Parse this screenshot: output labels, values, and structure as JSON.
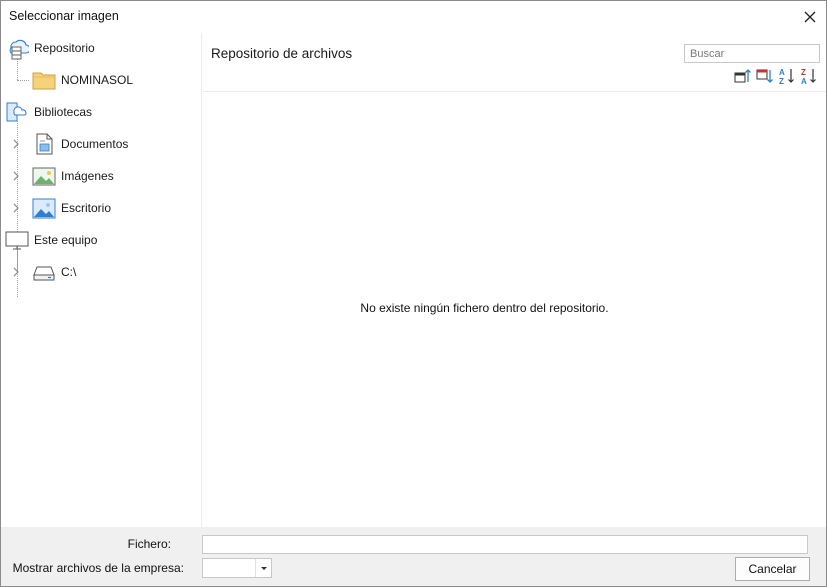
{
  "window": {
    "title": "Seleccionar imagen",
    "close_icon": "close-icon"
  },
  "sidebar": {
    "items": [
      {
        "label": "Repositorio",
        "icon": "cloud-server-icon"
      },
      {
        "label": "NOMINASOL",
        "icon": "folder-icon"
      },
      {
        "label": "Bibliotecas",
        "icon": "library-cloud-icon"
      },
      {
        "label": "Documentos",
        "icon": "document-icon"
      },
      {
        "label": "Imágenes",
        "icon": "image-icon"
      },
      {
        "label": "Escritorio",
        "icon": "desktop-image-icon"
      },
      {
        "label": "Este equipo",
        "icon": "monitor-icon"
      },
      {
        "label": "C:\\",
        "icon": "drive-icon"
      }
    ]
  },
  "main": {
    "title": "Repositorio de archivos",
    "search": {
      "placeholder": "Buscar",
      "value": ""
    },
    "toolbar": [
      {
        "icon": "sort-date-asc-icon"
      },
      {
        "icon": "sort-date-desc-icon"
      },
      {
        "icon": "sort-az-icon"
      },
      {
        "icon": "sort-za-icon"
      }
    ],
    "empty_message": "No existe ningún fichero dentro del repositorio."
  },
  "footer": {
    "fichero_label": "Fichero:",
    "fichero_value": "",
    "empresa_label": "Mostrar archivos de la empresa:",
    "empresa_value": "",
    "cancel_label": "Cancelar"
  },
  "colors": {
    "accent_blue": "#2f7fd1",
    "folder_yellow": "#f6d27a",
    "footer_bg": "#f0f0f0"
  }
}
